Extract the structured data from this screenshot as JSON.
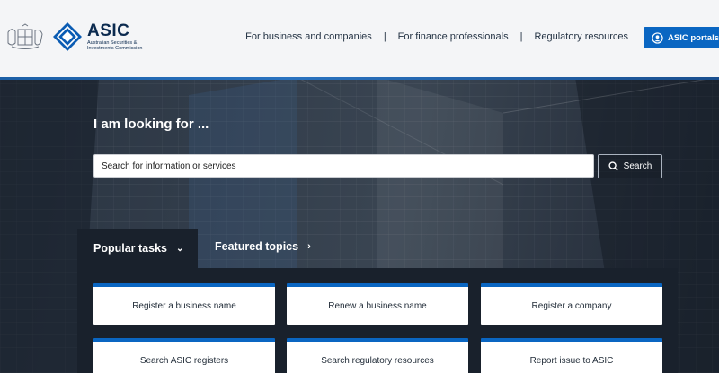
{
  "header": {
    "logo": {
      "word": "ASIC",
      "sub_line1": "Australian Securities &",
      "sub_line2": "Investments Commission"
    },
    "nav": [
      {
        "label": "For business and companies"
      },
      {
        "label": "For finance professionals"
      },
      {
        "label": "Regulatory resources"
      }
    ],
    "separator": "|",
    "portals_label": "ASIC portals"
  },
  "hero": {
    "heading": "I am looking for ...",
    "search": {
      "placeholder": "Search for information or services",
      "value": "",
      "button_label": "Search"
    }
  },
  "tabs": {
    "popular": {
      "label": "Popular tasks",
      "icon": "chevron-down-icon"
    },
    "featured": {
      "label": "Featured topics",
      "icon": "chevron-right-icon"
    }
  },
  "tasks": [
    {
      "label": "Register a business name"
    },
    {
      "label": "Renew a business name"
    },
    {
      "label": "Register a company"
    },
    {
      "label": "Search ASIC registers"
    },
    {
      "label": "Search regulatory resources"
    },
    {
      "label": "Report issue to ASIC"
    }
  ],
  "colors": {
    "accent": "#0a66c2",
    "header_bg": "#f4f5f7",
    "panel_bg": "#19212c"
  }
}
